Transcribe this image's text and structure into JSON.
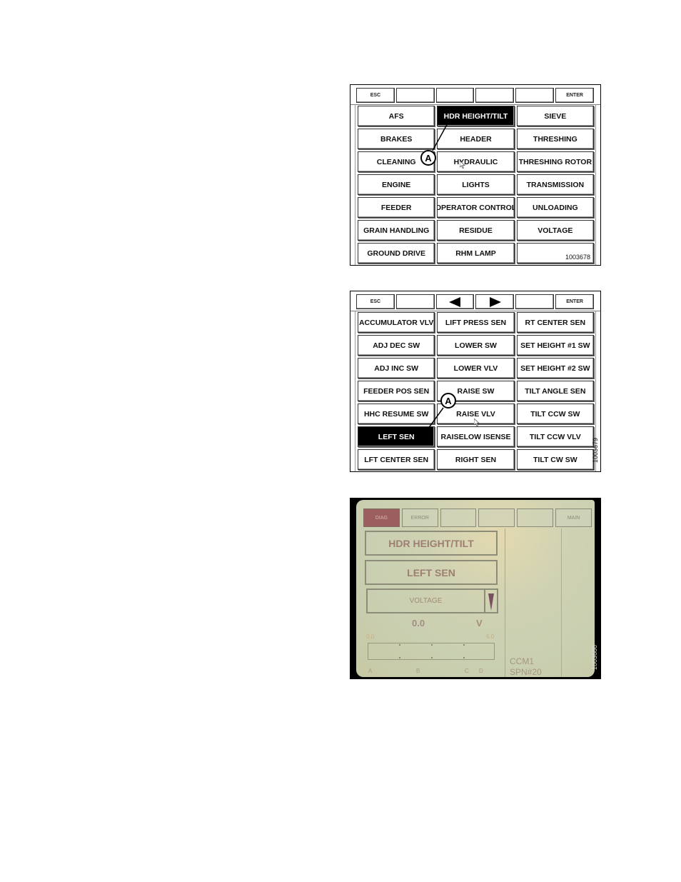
{
  "figure1": {
    "top_keys": [
      "ESC",
      "",
      "",
      "",
      "",
      "ENTER"
    ],
    "buttons": [
      {
        "label": "AFS"
      },
      {
        "label": "HDR HEIGHT/TILT",
        "selected": true
      },
      {
        "label": "SIEVE"
      },
      {
        "label": "BRAKES"
      },
      {
        "label": "HEADER"
      },
      {
        "label": "THRESHING"
      },
      {
        "label": "CLEANING"
      },
      {
        "label": "HYDRAULIC"
      },
      {
        "label": "THRESHING ROTOR"
      },
      {
        "label": "ENGINE"
      },
      {
        "label": "LIGHTS"
      },
      {
        "label": "TRANSMISSION"
      },
      {
        "label": "FEEDER"
      },
      {
        "label": "OPERATOR CONTROL"
      },
      {
        "label": "UNLOADING"
      },
      {
        "label": "GRAIN HANDLING"
      },
      {
        "label": "RESIDUE"
      },
      {
        "label": "VOLTAGE"
      },
      {
        "label": "GROUND DRIVE"
      },
      {
        "label": "RHM LAMP"
      },
      {
        "label": ""
      }
    ],
    "callout": "A",
    "figure_id": "1003678"
  },
  "figure2": {
    "top_keys": [
      "ESC",
      "",
      "left-arrow-icon",
      "right-arrow-icon",
      "",
      "ENTER"
    ],
    "buttons": [
      {
        "label": "ACCUMULATOR VLV"
      },
      {
        "label": "LIFT PRESS SEN"
      },
      {
        "label": "RT CENTER SEN"
      },
      {
        "label": "ADJ DEC SW"
      },
      {
        "label": "LOWER SW"
      },
      {
        "label": "SET HEIGHT #1 SW"
      },
      {
        "label": "ADJ INC SW"
      },
      {
        "label": "LOWER VLV"
      },
      {
        "label": "SET HEIGHT #2 SW"
      },
      {
        "label": "FEEDER POS SEN"
      },
      {
        "label": "RAISE SW"
      },
      {
        "label": "TILT ANGLE SEN"
      },
      {
        "label": "HHC RESUME SW"
      },
      {
        "label": "RAISE VLV"
      },
      {
        "label": "TILT CCW SW"
      },
      {
        "label": "LEFT SEN",
        "selected": true
      },
      {
        "label": "RAISELOW ISENSE"
      },
      {
        "label": "TILT CCW VLV"
      },
      {
        "label": "LFT CENTER SEN"
      },
      {
        "label": "RIGHT SEN"
      },
      {
        "label": "TILT CW SW"
      }
    ],
    "callout": "A",
    "figure_id": "1003679"
  },
  "figure3": {
    "top_keys": [
      {
        "label": "DIAG",
        "active": true
      },
      {
        "label": "ERROR"
      },
      {
        "label": ""
      },
      {
        "label": ""
      },
      {
        "label": ""
      },
      {
        "label": "MAIN"
      }
    ],
    "category": "HDR HEIGHT/TILT",
    "sensor": "LEFT SEN",
    "dropdown_value": "VOLTAGE",
    "reading_value": "0.0",
    "reading_unit": "V",
    "scale_min": "0.0",
    "scale_max": "6.0",
    "bar_fill_fraction": 0.0,
    "scale_markers": [
      "A",
      "B",
      "C",
      "D"
    ],
    "controller": "CCM1",
    "spn": "SPN#20",
    "figure_id": "1003680"
  }
}
